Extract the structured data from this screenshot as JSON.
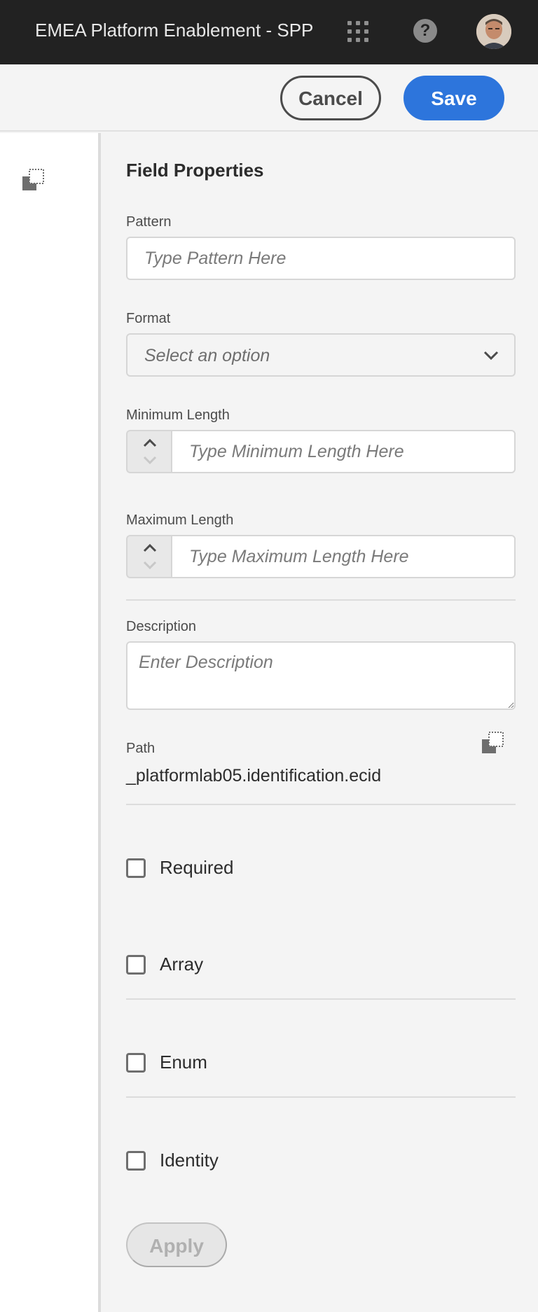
{
  "header": {
    "org_name": "EMEA Platform Enablement - SPP",
    "help_glyph": "?"
  },
  "actions": {
    "cancel_label": "Cancel",
    "save_label": "Save"
  },
  "field_properties": {
    "title": "Field Properties",
    "pattern": {
      "label": "Pattern",
      "placeholder": "Type Pattern Here",
      "value": ""
    },
    "format": {
      "label": "Format",
      "selected": "Select an option"
    },
    "min_length": {
      "label": "Minimum Length",
      "placeholder": "Type Minimum Length Here"
    },
    "max_length": {
      "label": "Maximum Length",
      "placeholder": "Type Maximum Length Here"
    },
    "description": {
      "label": "Description",
      "placeholder": "Enter Description"
    },
    "path": {
      "label": "Path",
      "value": "_platformlab05.identification.ecid"
    },
    "checkboxes": [
      {
        "label": "Required",
        "checked": false
      },
      {
        "label": "Array",
        "checked": false
      },
      {
        "label": "Enum",
        "checked": false
      },
      {
        "label": "Identity",
        "checked": false
      }
    ],
    "apply_label": "Apply"
  },
  "icons": {
    "apps": "apps-grid-icon",
    "help": "help-icon",
    "copy": "copy-icon",
    "chevron": "chevron-down-icon",
    "step_up": "chevron-up-icon",
    "step_down": "chevron-down-icon"
  },
  "colors": {
    "topbar_bg": "#222222",
    "primary": "#2d75dc",
    "panel_bg": "#f4f4f4",
    "disabled_bg": "#e6e6e6"
  }
}
